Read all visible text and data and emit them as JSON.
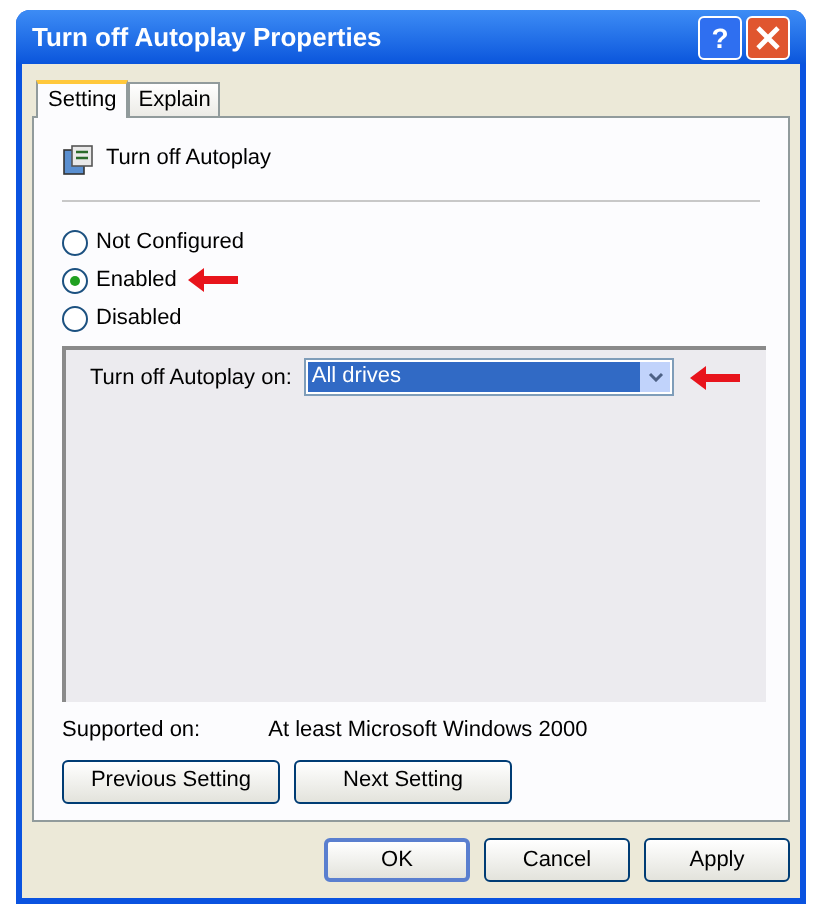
{
  "window": {
    "title": "Turn off Autoplay Properties",
    "help": "?"
  },
  "tabs": [
    {
      "label": "Setting",
      "selected": true
    },
    {
      "label": "Explain",
      "selected": false
    }
  ],
  "policy": {
    "name": "Turn off Autoplay"
  },
  "options": [
    {
      "label": "Not Configured",
      "selected": false
    },
    {
      "label": "Enabled",
      "selected": true
    },
    {
      "label": "Disabled",
      "selected": false
    }
  ],
  "setting": {
    "label": "Turn off Autoplay on:",
    "value": "All drives"
  },
  "supported": {
    "label": "Supported on:",
    "value": "At least Microsoft Windows 2000"
  },
  "nav_buttons": [
    {
      "label": "Previous Setting"
    },
    {
      "label": "Next Setting"
    }
  ],
  "buttons": [
    {
      "label": "OK",
      "default": true
    },
    {
      "label": "Cancel",
      "default": false
    },
    {
      "label": "Apply",
      "default": false
    }
  ]
}
